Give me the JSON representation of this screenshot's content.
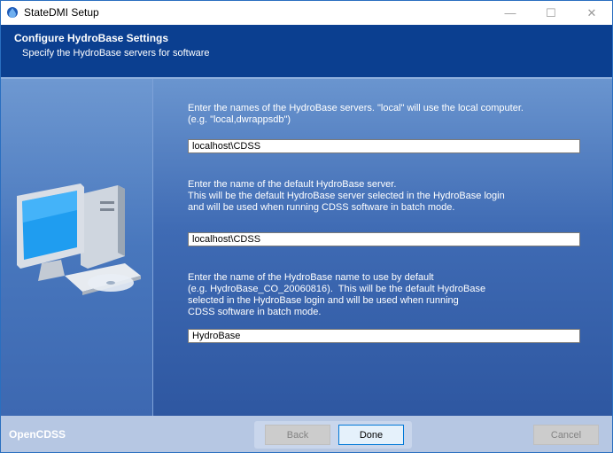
{
  "window": {
    "title": "StateDMI Setup",
    "controls": {
      "minimize": "—",
      "maximize": "☐",
      "close": "✕"
    }
  },
  "header": {
    "title": "Configure HydroBase Settings",
    "subtitle": "Specify the HydroBase servers for software"
  },
  "form": {
    "servers_label": "Enter the names of the HydroBase servers. \"local\" will use the local computer.\n(e.g. \"local,dwrappsdb\")",
    "servers_value": "localhost\\CDSS",
    "default_server_label": "Enter the name of the default HydroBase server.\nThis will be the default HydroBase server selected in the HydroBase login\nand will be used when running CDSS software in batch mode.",
    "default_server_value": "localhost\\CDSS",
    "default_name_label": "Enter the name of the HydroBase name to use by default\n(e.g. HydroBase_CO_20060816).  This will be the default HydroBase\nselected in the HydroBase login and will be used when running\nCDSS software in batch mode.",
    "default_name_value": "HydroBase"
  },
  "footer": {
    "brand": "OpenCDSS",
    "back_label": "Back",
    "done_label": "Done",
    "cancel_label": "Cancel"
  },
  "colors": {
    "banner": "#0b3f90",
    "body_gradient_top": "#6a95cf",
    "body_gradient_bottom": "#2e57a1",
    "footer": "#b6c7e3"
  },
  "icons": {
    "app": "water-drop-icon",
    "illustration": "computer-illustration"
  }
}
